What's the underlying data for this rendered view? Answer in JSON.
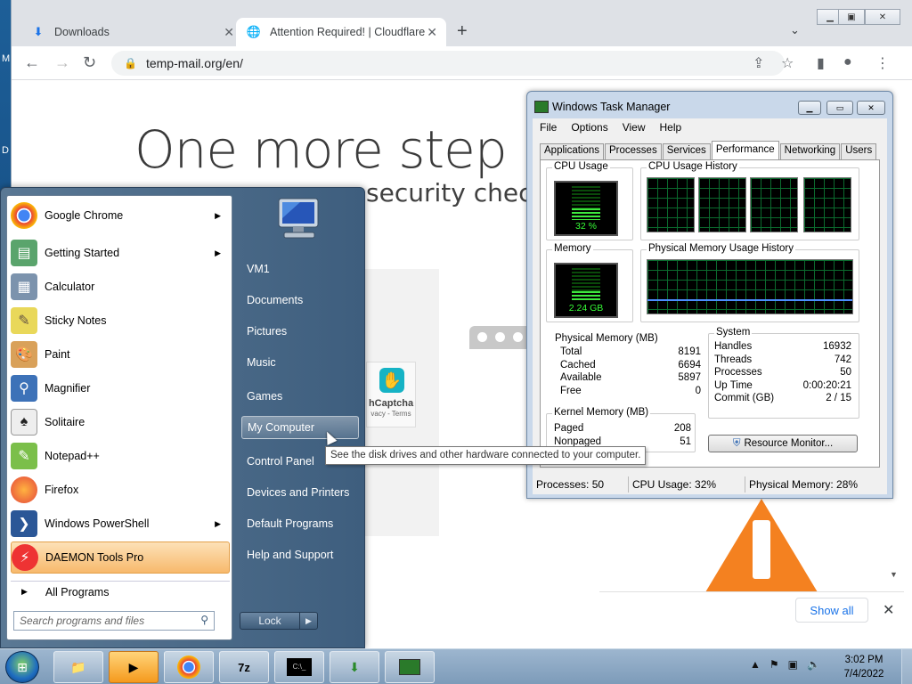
{
  "desktop": {
    "edge_letters": [
      "M",
      "D"
    ]
  },
  "chrome": {
    "tabs": [
      {
        "label": "Downloads",
        "icon": "download-icon"
      },
      {
        "label": "Attention Required! | Cloudflare",
        "icon": "globe-icon"
      }
    ],
    "url": "temp-mail.org/en/",
    "page": {
      "headline": "One more step",
      "subline_visible": "security check",
      "captcha_label": "hCaptcha",
      "captcha_small": "vacy - Terms"
    },
    "download_bar": {
      "show_all": "Show all"
    }
  },
  "task_manager": {
    "title": "Windows Task Manager",
    "menu": [
      "File",
      "Options",
      "View",
      "Help"
    ],
    "tabs": [
      "Applications",
      "Processes",
      "Services",
      "Performance",
      "Networking",
      "Users"
    ],
    "active_tab": "Performance",
    "cpu_usage": {
      "title": "CPU Usage",
      "value": "32 %",
      "level": 0.32
    },
    "cpu_history_title": "CPU Usage History",
    "memory": {
      "title": "Memory",
      "value": "2.24 GB",
      "level": 0.28
    },
    "mem_history_title": "Physical Memory Usage History",
    "physical_memory": {
      "title": "Physical Memory (MB)",
      "rows": [
        {
          "k": "Total",
          "v": "8191"
        },
        {
          "k": "Cached",
          "v": "6694"
        },
        {
          "k": "Available",
          "v": "5897"
        },
        {
          "k": "Free",
          "v": "0"
        }
      ]
    },
    "kernel_memory": {
      "title": "Kernel Memory (MB)",
      "rows": [
        {
          "k": "Paged",
          "v": "208"
        },
        {
          "k": "Nonpaged",
          "v": "51"
        }
      ]
    },
    "system": {
      "title": "System",
      "rows": [
        {
          "k": "Handles",
          "v": "16932"
        },
        {
          "k": "Threads",
          "v": "742"
        },
        {
          "k": "Processes",
          "v": "50"
        },
        {
          "k": "Up Time",
          "v": "0:00:20:21"
        },
        {
          "k": "Commit (GB)",
          "v": "2 / 15"
        }
      ]
    },
    "resource_monitor": "Resource Monitor...",
    "status": {
      "processes": "Processes: 50",
      "cpu": "CPU Usage: 32%",
      "memory": "Physical Memory: 28%"
    }
  },
  "start_menu": {
    "programs": [
      {
        "label": "Google Chrome",
        "has_arrow": true,
        "icon": "chrome-icon"
      },
      {
        "label": "Getting Started",
        "has_arrow": true,
        "icon": "getting-started-icon"
      },
      {
        "label": "Calculator",
        "has_arrow": false,
        "icon": "calculator-icon"
      },
      {
        "label": "Sticky Notes",
        "has_arrow": false,
        "icon": "sticky-notes-icon"
      },
      {
        "label": "Paint",
        "has_arrow": false,
        "icon": "paint-icon"
      },
      {
        "label": "Magnifier",
        "has_arrow": false,
        "icon": "magnifier-icon"
      },
      {
        "label": "Solitaire",
        "has_arrow": false,
        "icon": "solitaire-icon"
      },
      {
        "label": "Notepad++",
        "has_arrow": false,
        "icon": "notepadpp-icon"
      },
      {
        "label": "Firefox",
        "has_arrow": false,
        "icon": "firefox-icon"
      },
      {
        "label": "Windows PowerShell",
        "has_arrow": true,
        "icon": "powershell-icon"
      },
      {
        "label": "DAEMON Tools Pro",
        "has_arrow": false,
        "icon": "daemon-tools-icon"
      }
    ],
    "all_programs": "All Programs",
    "search_placeholder": "Search programs and files",
    "right_items": [
      "VM1",
      "Documents",
      "Pictures",
      "Music",
      "Games",
      "My Computer",
      "Control Panel",
      "Devices and Printers",
      "Default Programs",
      "Help and Support"
    ],
    "highlighted_right": "My Computer",
    "lock_label": "Lock",
    "tooltip": "See the disk drives and other hardware connected to your computer."
  },
  "taskbar": {
    "buttons": [
      "explorer-icon",
      "media-player-icon",
      "chrome-icon",
      "7zip-icon",
      "cmd-icon",
      "installer-icon",
      "task-manager-icon"
    ],
    "clock_time": "3:02 PM",
    "clock_date": "7/4/2022"
  }
}
